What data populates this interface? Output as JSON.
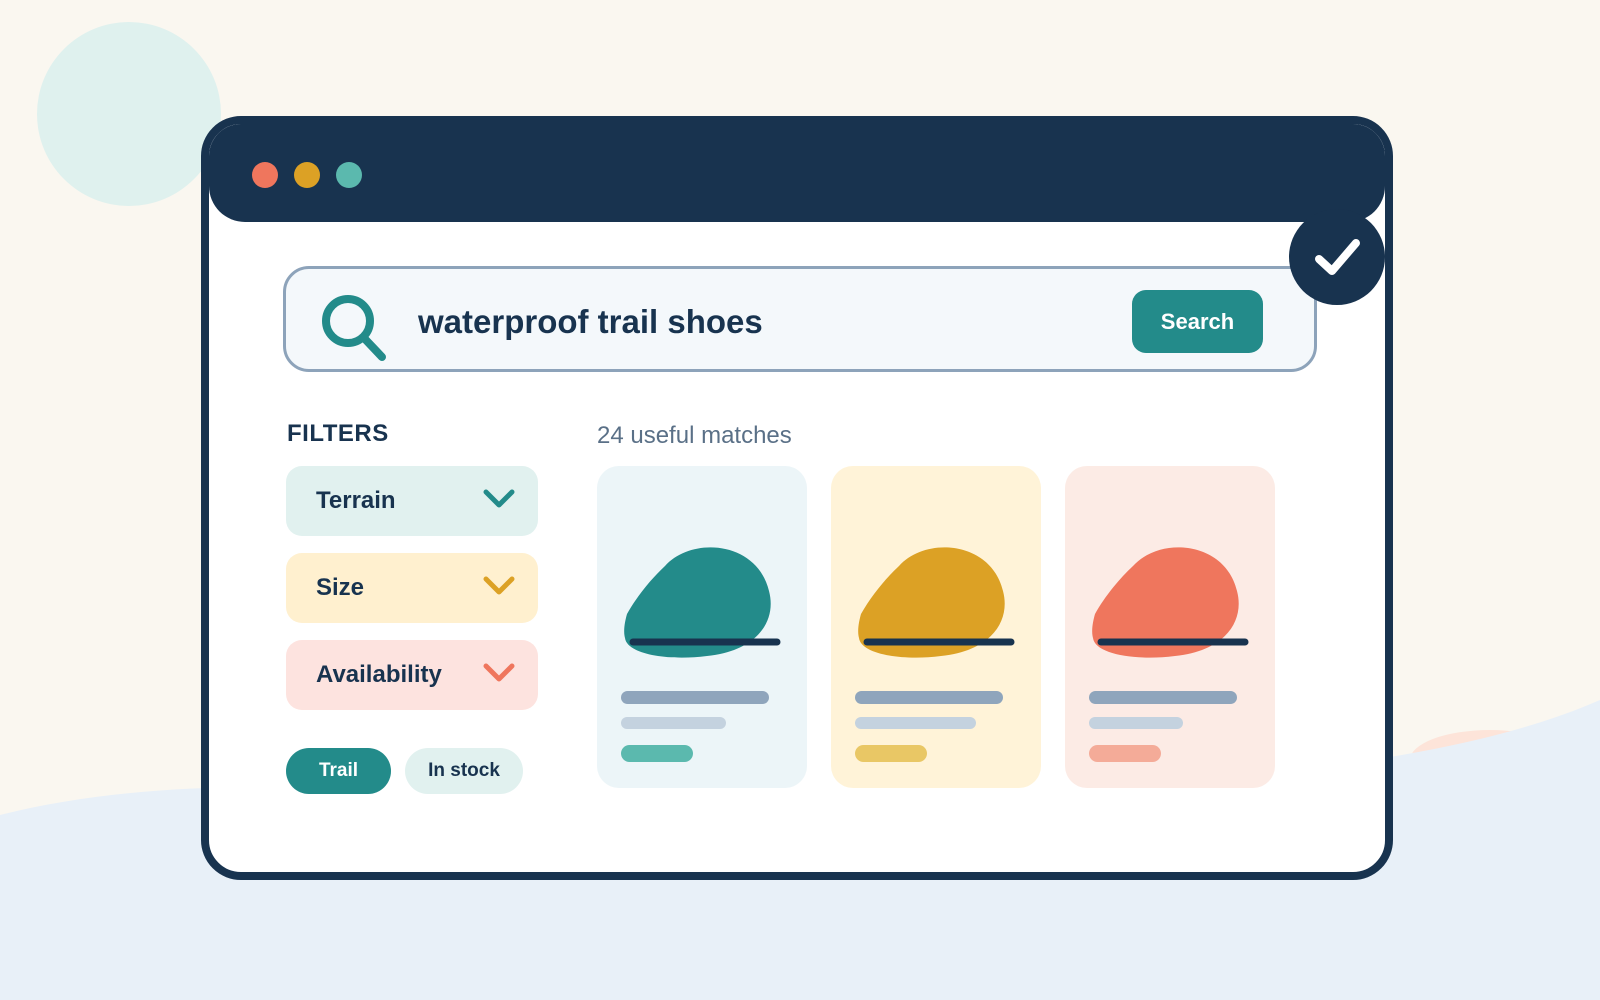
{
  "search": {
    "query": "waterproof trail shoes",
    "button_label": "Search"
  },
  "filters": {
    "title": "FILTERS",
    "items": [
      {
        "label": "Terrain"
      },
      {
        "label": "Size"
      },
      {
        "label": "Availability"
      }
    ]
  },
  "chips": [
    {
      "label": "Trail",
      "active": true
    },
    {
      "label": "In stock",
      "active": false
    }
  ],
  "results": {
    "summary": "24 useful matches",
    "cards": [
      {
        "shoe_color": "#238b8a",
        "bg_color": "#ecf5f8",
        "tag_color": "#5bb9ae"
      },
      {
        "shoe_color": "#dca125",
        "bg_color": "#fff3d8",
        "tag_color": "#e9c765"
      },
      {
        "shoe_color": "#ef765d",
        "bg_color": "#fcebe5",
        "tag_color": "#f4ab98"
      }
    ]
  },
  "colors": {
    "navy": "#18334f",
    "teal": "#238b8a",
    "mustard": "#dca125",
    "coral": "#ef765d",
    "window_dot_red": "#ef765d",
    "window_dot_yellow": "#dca125",
    "window_dot_green": "#5bb9ae"
  },
  "icons": {
    "search": "magnifier-icon",
    "filter_toggle": "chevron-down-icon",
    "status": "checkmark-icon"
  }
}
